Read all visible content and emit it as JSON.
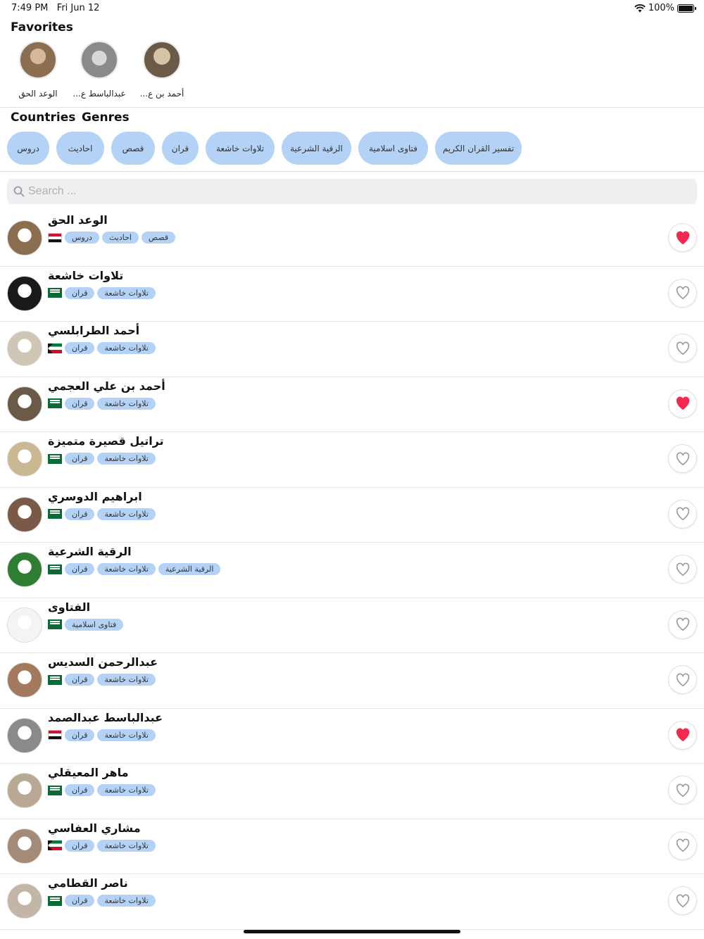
{
  "status_bar": {
    "time": "7:49 PM",
    "date": "Fri Jun 12",
    "battery": "100%"
  },
  "favorites": {
    "title": "Favorites",
    "items": [
      {
        "name": "أحمد بن ع...",
        "avatar_color": "#6b5a48"
      },
      {
        "name": "عبدالباسط ع...",
        "avatar_color": "#8a8a8a"
      },
      {
        "name": "الوعد الحق",
        "avatar_color": "#8b6d4f"
      }
    ]
  },
  "tabs": {
    "countries": "Countries",
    "genres": "Genres"
  },
  "genres": [
    "دروس",
    "احاديث",
    "قصص",
    "قران",
    "تلاوات خاشعة",
    "الرقية الشرعية",
    "فتاوى اسلامية",
    "تفسير القران الكريم"
  ],
  "search": {
    "placeholder": "Search ..."
  },
  "colors": {
    "chip_bg": "#b4d2f5",
    "heart_filled": "#f5294f",
    "heart_outline": "#9a9a9a"
  },
  "list": [
    {
      "name": "الوعد الحق",
      "flag": "eg",
      "tags": [
        "دروس",
        "احاديث",
        "قصص"
      ],
      "favorite": true,
      "avatar_color": "#8b6d4f"
    },
    {
      "name": "تلاوات خاشعة",
      "flag": "sa",
      "tags": [
        "قران",
        "تلاوات خاشعة"
      ],
      "favorite": false,
      "avatar_color": "#1a1a1a"
    },
    {
      "name": "أحمد الطرابلسي",
      "flag": "kw",
      "tags": [
        "قران",
        "تلاوات خاشعة"
      ],
      "favorite": false,
      "avatar_color": "#cfc6b6"
    },
    {
      "name": "أحمد بن علي العجمي",
      "flag": "sa",
      "tags": [
        "قران",
        "تلاوات خاشعة"
      ],
      "favorite": true,
      "avatar_color": "#6b5a48"
    },
    {
      "name": "تراتيل قصيرة متميزة",
      "flag": "sa",
      "tags": [
        "قران",
        "تلاوات خاشعة"
      ],
      "favorite": false,
      "avatar_color": "#c9b892"
    },
    {
      "name": "ابراهيم الدوسري",
      "flag": "sa",
      "tags": [
        "قران",
        "تلاوات خاشعة"
      ],
      "favorite": false,
      "avatar_color": "#7a5a46"
    },
    {
      "name": "الرقية الشرعية",
      "flag": "sa",
      "tags": [
        "قران",
        "تلاوات خاشعة",
        "الرقية الشرعية"
      ],
      "favorite": false,
      "avatar_color": "#2e7d32"
    },
    {
      "name": "الفتاوى",
      "flag": "sa",
      "tags": [
        "فتاوى اسلامية"
      ],
      "favorite": false,
      "avatar_color": "#f4f4f4"
    },
    {
      "name": "عبدالرحمن السديس",
      "flag": "sa",
      "tags": [
        "قران",
        "تلاوات خاشعة"
      ],
      "favorite": false,
      "avatar_color": "#a37a5e"
    },
    {
      "name": "عبدالباسط عبدالصمد",
      "flag": "eg",
      "tags": [
        "قران",
        "تلاوات خاشعة"
      ],
      "favorite": true,
      "avatar_color": "#8a8a8a"
    },
    {
      "name": "ماهر المعيقلي",
      "flag": "sa",
      "tags": [
        "قران",
        "تلاوات خاشعة"
      ],
      "favorite": false,
      "avatar_color": "#b9a894"
    },
    {
      "name": "مشاري العفاسي",
      "flag": "kw",
      "tags": [
        "قران",
        "تلاوات خاشعة"
      ],
      "favorite": false,
      "avatar_color": "#a38b78"
    },
    {
      "name": "ناصر القطامي",
      "flag": "sa",
      "tags": [
        "قران",
        "تلاوات خاشعة"
      ],
      "favorite": false,
      "avatar_color": "#c4b6a6"
    }
  ]
}
